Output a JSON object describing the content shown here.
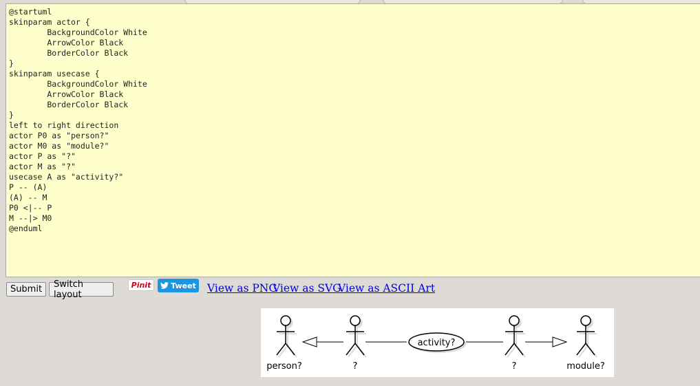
{
  "editor": {
    "source": "@startuml\nskinparam actor {\n        BackgroundColor White\n        ArrowColor Black\n        BorderColor Black\n}\nskinparam usecase {\n        BackgroundColor White\n        ArrowColor Black\n        BorderColor Black\n}\nleft to right direction\nactor P0 as \"person?\"\nactor M0 as \"module?\"\nactor P as \"?\"\nactor M as \"?\"\nusecase A as \"activity?\"\nP -- (A)\n(A) -- M\nP0 <|-- P\nM --|> M0\n@enduml"
  },
  "buttons": {
    "submit": "Submit",
    "switch_layout": "Switch layout"
  },
  "social": {
    "pinit": "Pinit",
    "tweet": "Tweet"
  },
  "links": {
    "png": "View as PNG",
    "svg": "View as SVG",
    "ascii": "View as ASCII Art"
  },
  "diagram": {
    "actors": {
      "person": "person?",
      "p": "?",
      "m": "?",
      "module": "module?"
    },
    "usecase": "activity?"
  },
  "colors": {
    "page_bg": "#dedbd6",
    "editor_bg": "#ffffcc",
    "link": "#0000ee",
    "tweet_bg": "#1b95e0",
    "pinit_red": "#bd081c"
  }
}
